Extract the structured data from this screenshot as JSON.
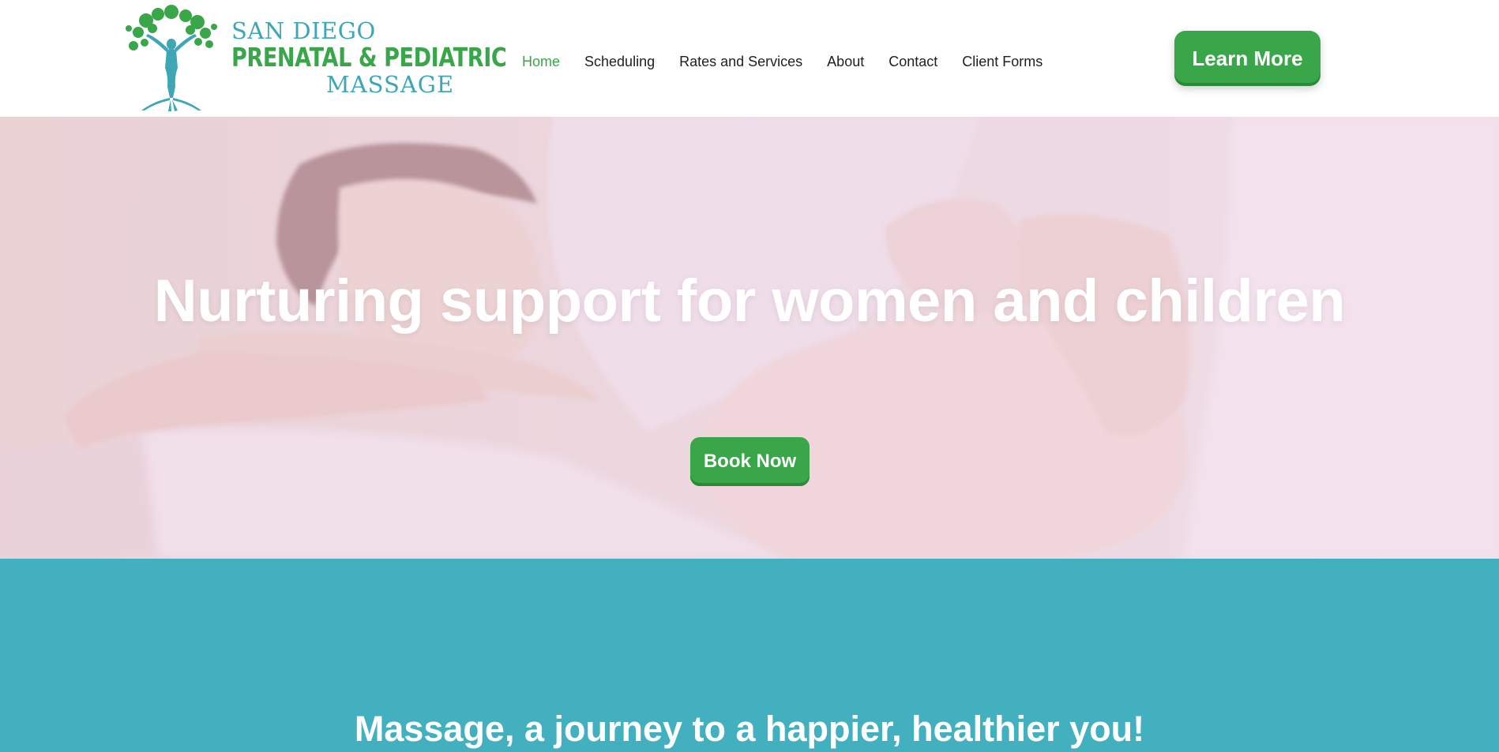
{
  "logo": {
    "line1": "SAN DIEGO",
    "line2": "PRENATAL & PEDIATRIC",
    "line3": "MASSAGE",
    "icon": "tree-woman-icon"
  },
  "nav": {
    "items": [
      {
        "label": "Home",
        "active": true
      },
      {
        "label": "Scheduling"
      },
      {
        "label": "Rates and Services"
      },
      {
        "label": "About"
      },
      {
        "label": "Contact"
      },
      {
        "label": "Client Forms"
      }
    ]
  },
  "header": {
    "cta_label": "Learn More"
  },
  "hero": {
    "title": "Nurturing support for women and children",
    "button_label": "Book Now"
  },
  "section": {
    "heading": "Massage, a journey to a happier, healthier you!"
  },
  "colors": {
    "brand_green": "#3aa64a",
    "brand_teal": "#43b0c0",
    "nav_text": "#1f1f1f"
  }
}
